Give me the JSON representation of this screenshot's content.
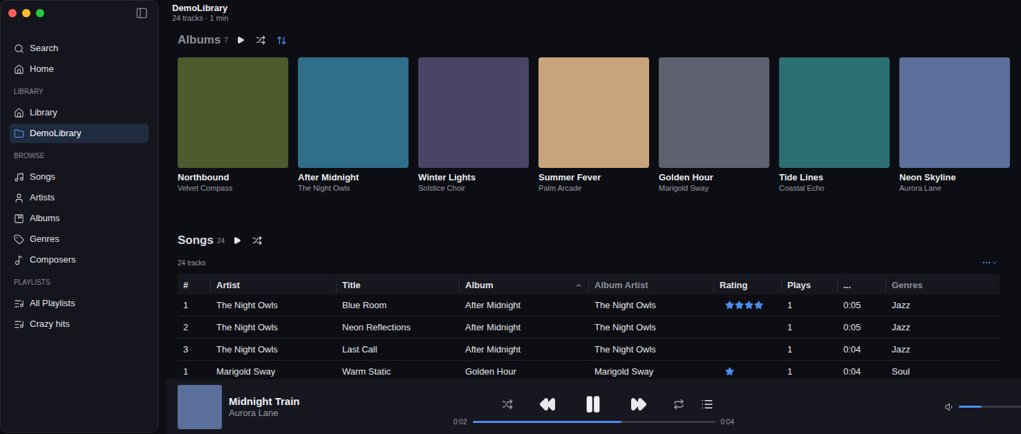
{
  "window": {
    "title": "DemoLibrary",
    "subtitle": "24 tracks · 1 min"
  },
  "sidebar": {
    "sections": [
      {
        "label": "",
        "items": [
          {
            "label": "Search",
            "selected": false
          },
          {
            "label": "Home",
            "selected": false
          }
        ]
      },
      {
        "label": "LIBRARY",
        "items": [
          {
            "label": "Library",
            "selected": false
          },
          {
            "label": "DemoLibrary",
            "selected": true
          }
        ]
      },
      {
        "label": "BROWSE",
        "items": [
          {
            "label": "Songs",
            "selected": false
          },
          {
            "label": "Artists",
            "selected": false
          },
          {
            "label": "Albums",
            "selected": false
          },
          {
            "label": "Genres",
            "selected": false
          },
          {
            "label": "Composers",
            "selected": false
          }
        ]
      },
      {
        "label": "PLAYLISTS",
        "items": [
          {
            "label": "All Playlists",
            "selected": false
          },
          {
            "label": "Crazy hits",
            "selected": false
          }
        ]
      }
    ]
  },
  "albums": {
    "title": "Albums",
    "count": "7",
    "sort_active": true,
    "items": [
      {
        "title": "Northbound",
        "artist": "Velvet Compass",
        "color": "#4f5a2c"
      },
      {
        "title": "After Midnight",
        "artist": "The Night Owls",
        "color": "#2f6f8a"
      },
      {
        "title": "Winter Lights",
        "artist": "Solstice Choir",
        "color": "#4a4566"
      },
      {
        "title": "Summer Fever",
        "artist": "Palm Arcade",
        "color": "#c8a37c"
      },
      {
        "title": "Golden Hour",
        "artist": "Marigold Sway",
        "color": "#5e6270"
      },
      {
        "title": "Tide Lines",
        "artist": "Coastal Echo",
        "color": "#2b6f73"
      },
      {
        "title": "Neon Skyline",
        "artist": "Aurora Lane",
        "color": "#5a6f9a"
      }
    ]
  },
  "songs": {
    "title": "Songs",
    "count": "24",
    "summary": "24 tracks",
    "columns": [
      {
        "label": "#",
        "dimmed": false,
        "sorted": false
      },
      {
        "label": "Artist",
        "dimmed": false,
        "sorted": false
      },
      {
        "label": "Title",
        "dimmed": false,
        "sorted": false
      },
      {
        "label": "Album",
        "dimmed": false,
        "sorted": true
      },
      {
        "label": "Album Artist",
        "dimmed": true,
        "sorted": false
      },
      {
        "label": "Rating",
        "dimmed": false,
        "sorted": false
      },
      {
        "label": "Plays",
        "dimmed": false,
        "sorted": false
      },
      {
        "label": "...",
        "dimmed": false,
        "sorted": false
      },
      {
        "label": "Genres",
        "dimmed": true,
        "sorted": false
      }
    ],
    "rows": [
      {
        "number": "1",
        "artist": "The Night Owls",
        "title": "Blue Room",
        "album": "After Midnight",
        "album_artist": "The Night Owls",
        "stars": 4,
        "plays": "1",
        "duration": "0:05",
        "genre": "Jazz"
      },
      {
        "number": "2",
        "artist": "The Night Owls",
        "title": "Neon Reflections",
        "album": "After Midnight",
        "album_artist": "The Night Owls",
        "stars": 0,
        "plays": "1",
        "duration": "0:05",
        "genre": "Jazz"
      },
      {
        "number": "3",
        "artist": "The Night Owls",
        "title": "Last Call",
        "album": "After Midnight",
        "album_artist": "The Night Owls",
        "stars": 0,
        "plays": "1",
        "duration": "0:04",
        "genre": "Jazz"
      },
      {
        "number": "1",
        "artist": "Marigold Sway",
        "title": "Warm Static",
        "album": "Golden Hour",
        "album_artist": "Marigold Sway",
        "stars": 1,
        "plays": "1",
        "duration": "0:04",
        "genre": "Soul"
      }
    ]
  },
  "player": {
    "title": "Midnight Train",
    "artist": "Aurora Lane",
    "art_color": "#5a6f9a",
    "playing": true,
    "shuffle": false,
    "repeat": false,
    "elapsed": "0:02",
    "total": "0:04",
    "level": 0.615,
    "volume": 0.37
  }
}
